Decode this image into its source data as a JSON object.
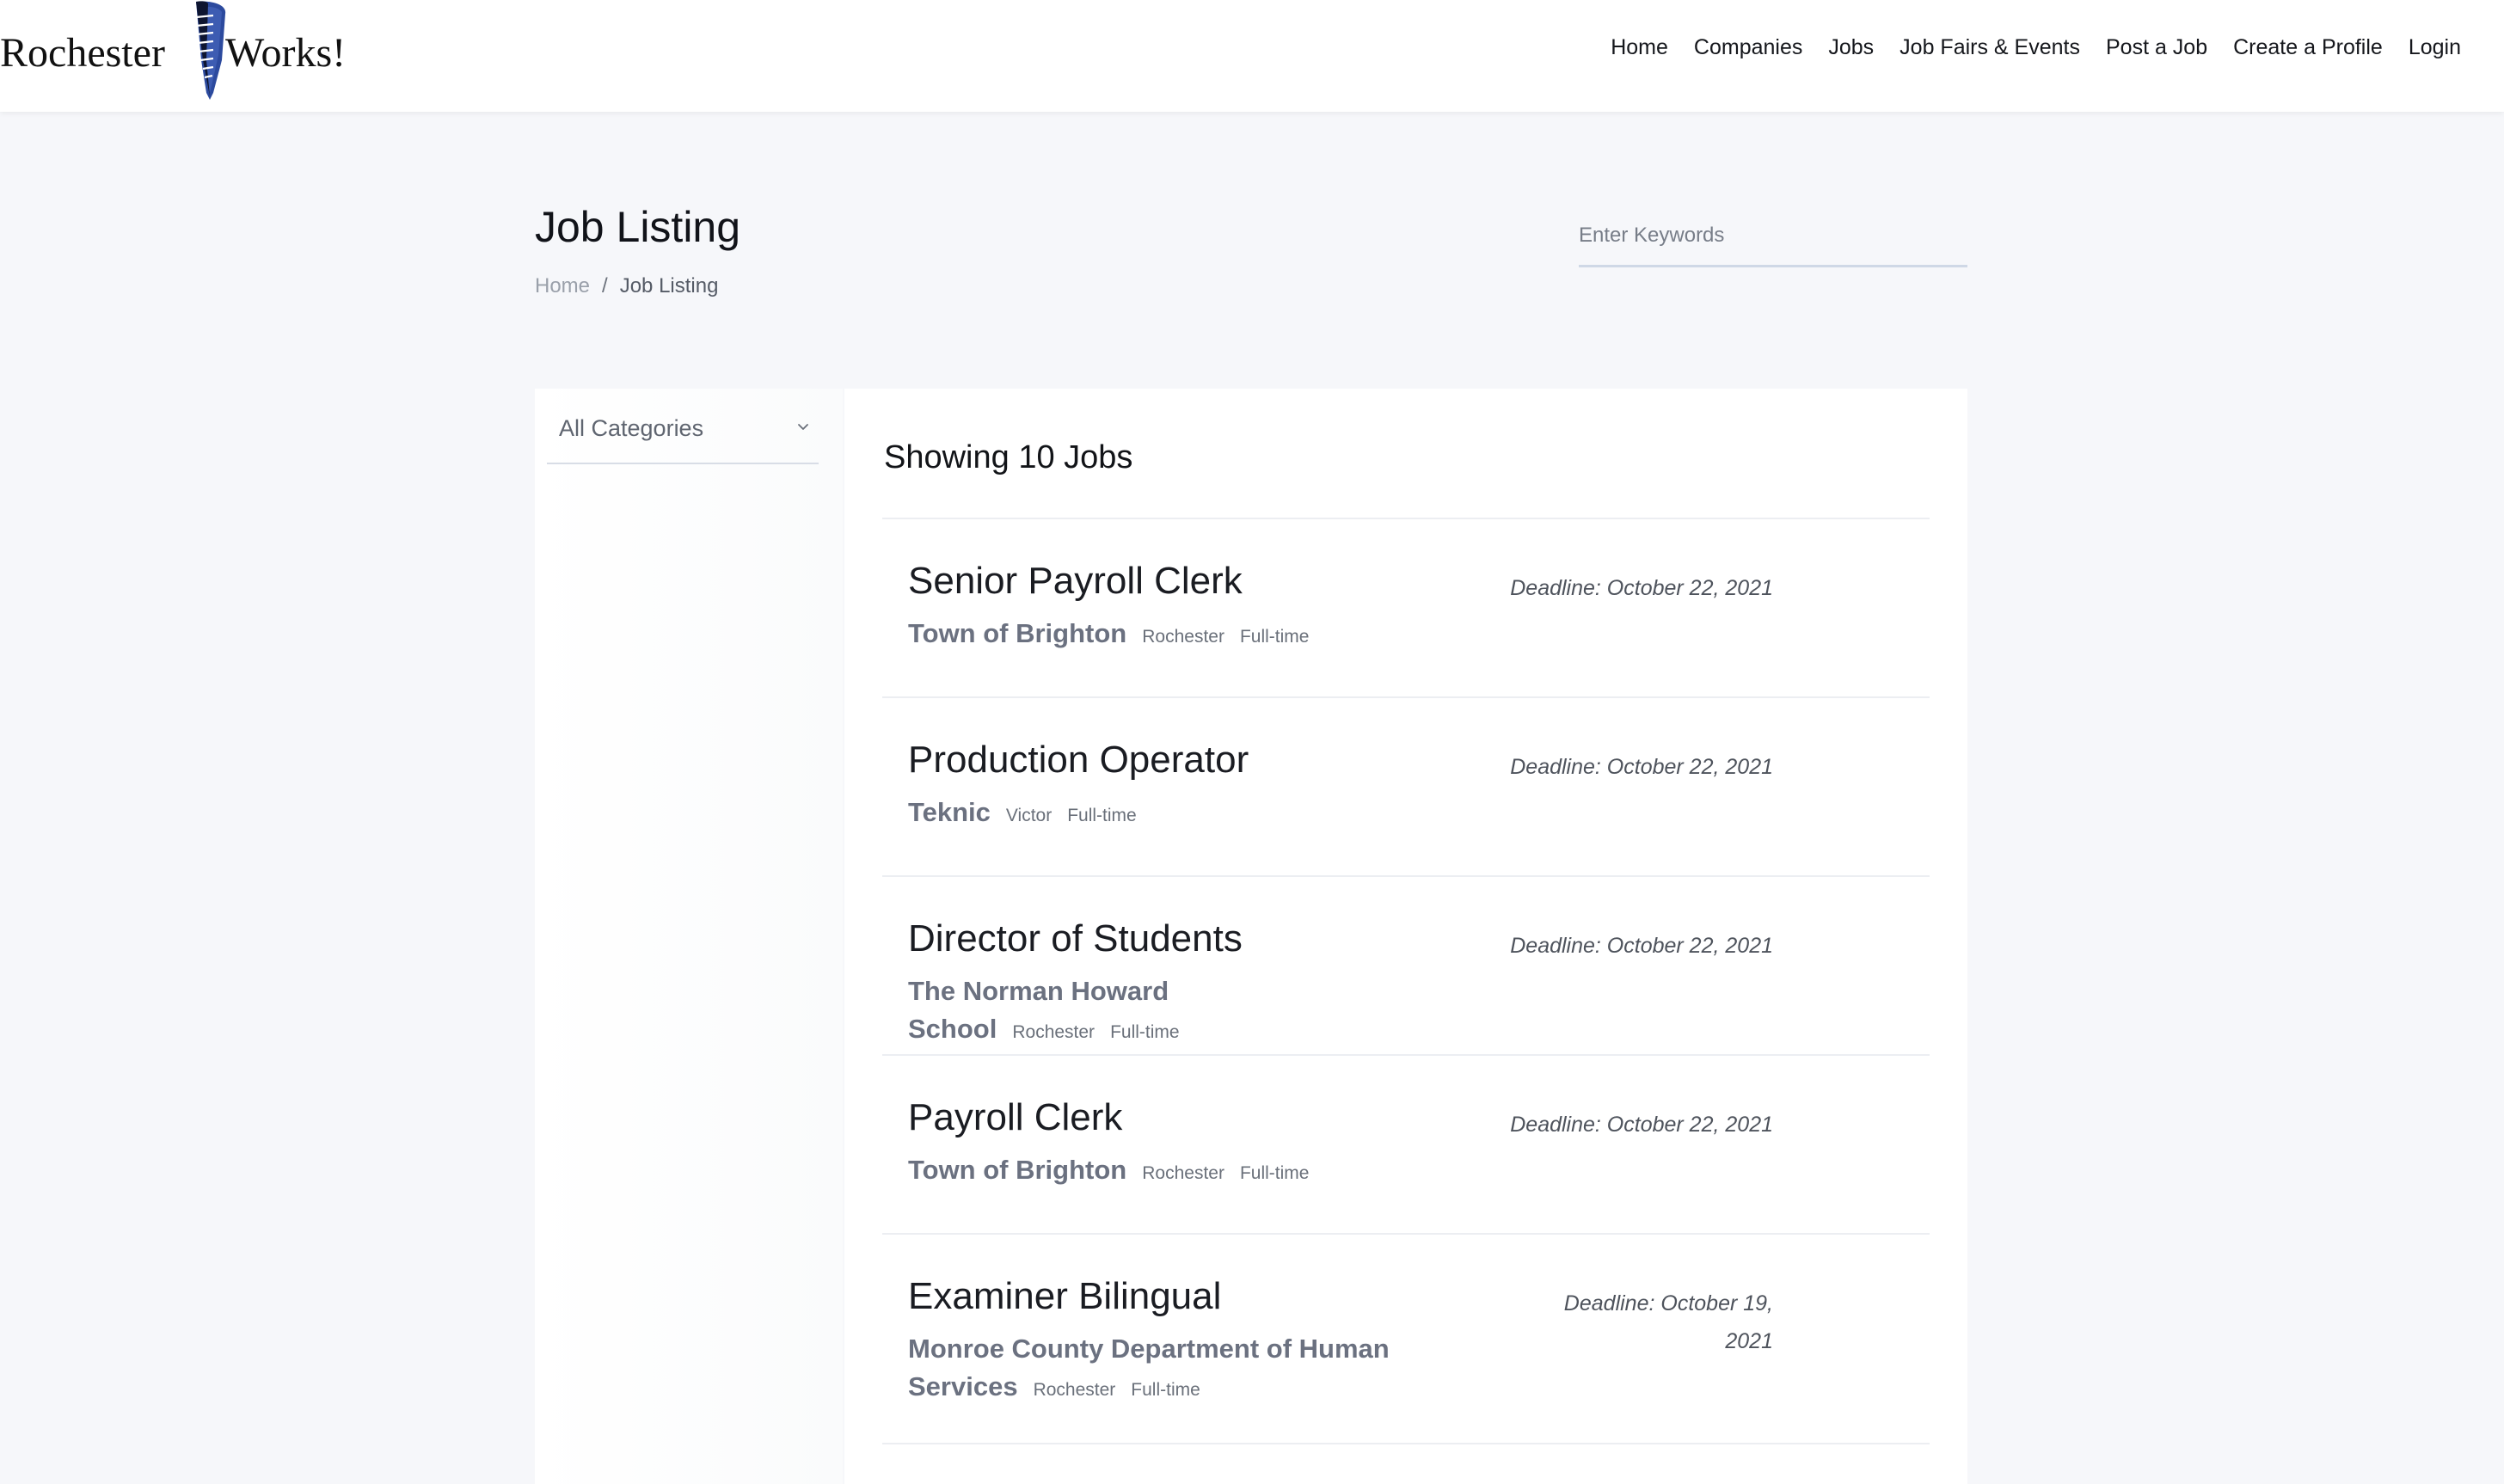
{
  "header": {
    "logo": {
      "text_left": "Rochester",
      "text_right": "Works!"
    },
    "nav": [
      {
        "label": "Home"
      },
      {
        "label": "Companies"
      },
      {
        "label": "Jobs"
      },
      {
        "label": "Job Fairs & Events"
      },
      {
        "label": "Post a Job"
      },
      {
        "label": "Create a Profile"
      },
      {
        "label": "Login"
      }
    ]
  },
  "page": {
    "title": "Job Listing",
    "breadcrumb": {
      "home": "Home",
      "separator": "/",
      "current": "Job Listing"
    },
    "search": {
      "placeholder": "Enter Keywords",
      "value": ""
    }
  },
  "sidebar": {
    "category_select": {
      "selected": "All Categories",
      "icon": "chevron-down-icon"
    }
  },
  "results": {
    "heading": "Showing 10 Jobs",
    "jobs": [
      {
        "title": "Senior Payroll Clerk",
        "company": "Town of Brighton",
        "location": "Rochester",
        "type": "Full-time",
        "deadline": "Deadline: October 22, 2021"
      },
      {
        "title": "Production Operator",
        "company": "Teknic",
        "location": "Victor",
        "type": "Full-time",
        "deadline": "Deadline: October 22, 2021"
      },
      {
        "title": "Director of Students",
        "company": "The Norman Howard School",
        "location": "Rochester",
        "type": "Full-time",
        "deadline": "Deadline: October 22, 2021"
      },
      {
        "title": "Payroll Clerk",
        "company": "Town of Brighton",
        "location": "Rochester",
        "type": "Full-time",
        "deadline": "Deadline: October 22, 2021"
      },
      {
        "title": "Examiner Bilingual",
        "company": "Monroe County Department of Human Services",
        "location": "Rochester",
        "type": "Full-time",
        "deadline": "Deadline: October 19, 2021"
      }
    ]
  },
  "colors": {
    "page_background": "#f6f7fa",
    "panel_background": "#ffffff",
    "logo_accent": "#2c4a9e",
    "company_text": "#6b7180",
    "divider": "#eceef2"
  }
}
